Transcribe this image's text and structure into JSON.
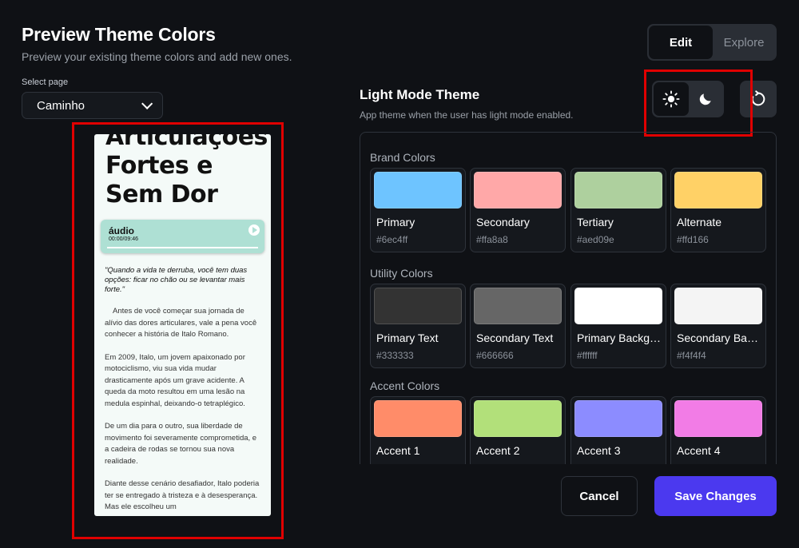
{
  "header": {
    "title": "Preview Theme Colors",
    "subtitle": "Preview your existing theme colors and add new ones."
  },
  "page_select": {
    "label": "Select page",
    "value": "Caminho"
  },
  "mode_tabs": {
    "edit": "Edit",
    "explore": "Explore",
    "active": "Edit"
  },
  "theme": {
    "title": "Light Mode Theme",
    "subtitle": "App theme when the user has light mode enabled.",
    "active_mode": "light"
  },
  "preview": {
    "heading": "Articulações Fortes e Sem Dor",
    "audio_title": "áudio",
    "audio_time": "00:00/09:46",
    "quote": "\"Quando a vida te derruba, você tem duas opções: ficar no chão ou se levantar mais forte.\"",
    "paragraphs": [
      "Antes de você começar sua jornada de alívio das dores articulares, vale a pena você conhecer a história de Italo Romano.",
      "Em 2009, Italo, um jovem apaixonado por motociclismo, viu sua vida mudar drasticamente após um grave acidente. A queda da moto resultou em uma lesão na medula espinhal, deixando-o tetraplégico.",
      "De um dia para o outro, sua liberdade de movimento foi severamente comprometida, e a cadeira de rodas se tornou sua nova realidade.",
      "Diante desse cenário desafiador, Italo poderia ter se entregado à tristeza e à desesperança. Mas ele escolheu um"
    ]
  },
  "groups": [
    {
      "title": "Brand Colors",
      "swatches": [
        {
          "name": "Primary",
          "hex": "#6ec4ff"
        },
        {
          "name": "Secondary",
          "hex": "#ffa8a8"
        },
        {
          "name": "Tertiary",
          "hex": "#aed09e"
        },
        {
          "name": "Alternate",
          "hex": "#ffd166"
        }
      ]
    },
    {
      "title": "Utility Colors",
      "swatches": [
        {
          "name": "Primary Text",
          "hex": "#333333"
        },
        {
          "name": "Secondary Text",
          "hex": "#666666"
        },
        {
          "name": "Primary Background",
          "hex": "#ffffff"
        },
        {
          "name": "Secondary Background",
          "hex": "#f4f4f4"
        }
      ]
    },
    {
      "title": "Accent Colors",
      "swatches": [
        {
          "name": "Accent 1",
          "hex": "",
          "color": "#ff8c69"
        },
        {
          "name": "Accent 2",
          "hex": "",
          "color": "#b2e07a"
        },
        {
          "name": "Accent 3",
          "hex": "",
          "color": "#8c8cff"
        },
        {
          "name": "Accent 4",
          "hex": "",
          "color": "#f27ce6"
        }
      ]
    }
  ],
  "footer": {
    "cancel": "Cancel",
    "save": "Save Changes"
  },
  "colors": {
    "background": "#0f1115",
    "primary_button": "#4b39ef",
    "highlight_box": "#e00000"
  }
}
